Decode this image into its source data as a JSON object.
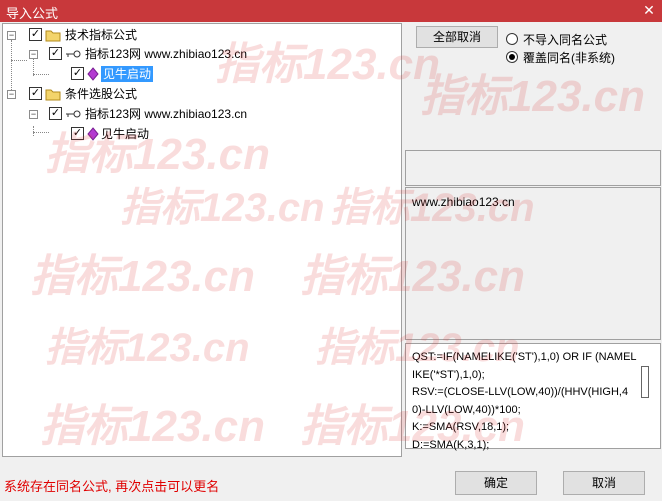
{
  "window": {
    "title": "导入公式",
    "close_glyph": "✕"
  },
  "tree": {
    "root1": {
      "label": "技术指标公式"
    },
    "root1_child": {
      "label": "指标123网 www.zhibiao123.cn"
    },
    "root1_leaf": {
      "label": "见牛启动"
    },
    "root2": {
      "label": "条件选股公式"
    },
    "root2_child": {
      "label": "指标123网 www.zhibiao123.cn"
    },
    "root2_leaf": {
      "label": "见牛启动"
    },
    "check_glyph": "✓",
    "minus_glyph": "−"
  },
  "options": {
    "cancel_all": "全部取消",
    "radio_no_import": "不导入同名公式",
    "radio_overwrite": "覆盖同名(非系统)",
    "selected": "radio_overwrite"
  },
  "details": {
    "url_text": "www.zhibiao123.cn",
    "code_text": "QST:=IF(NAMELIKE('ST'),1,0) OR IF (NAMELIKE('*ST'),1,0);\nRSV:=(CLOSE-LLV(LOW,40))/(HHV(HIGH,40)-LLV(LOW,40))*100;\nK:=SMA(RSV,18,1);\nD:=SMA(K,3,1);"
  },
  "footer": {
    "status": "系统存在同名公式, 再次点击可以更名",
    "ok": "确定",
    "cancel": "取消"
  },
  "watermark": {
    "text": "指标123.cn"
  },
  "colors": {
    "titlebar": "#c8383b",
    "status_text": "#e00000",
    "selection": "#3399ff",
    "watermark": "#dc3c3c"
  }
}
